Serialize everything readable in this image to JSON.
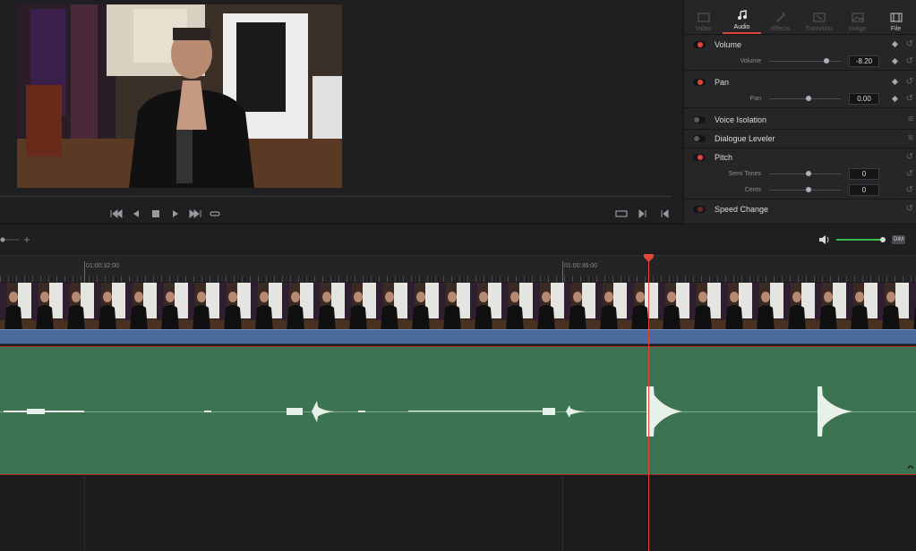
{
  "inspector": {
    "tabs": [
      {
        "label": "Video",
        "icon": "video-icon"
      },
      {
        "label": "Audio",
        "icon": "music-note-icon"
      },
      {
        "label": "Effects",
        "icon": "magic-wand-icon"
      },
      {
        "label": "Transition",
        "icon": "transition-icon"
      },
      {
        "label": "Image",
        "icon": "image-icon"
      },
      {
        "label": "File",
        "icon": "file-icon"
      }
    ],
    "active_tab": "Audio",
    "sections": {
      "volume": {
        "title": "Volume",
        "param_label": "Volume",
        "value": "-8.20",
        "level": 0.8
      },
      "pan": {
        "title": "Pan",
        "param_label": "Pan",
        "value": "0.00",
        "level": 0.55
      },
      "voice_isolation": {
        "title": "Voice Isolation"
      },
      "dialogue_leveler": {
        "title": "Dialogue Leveler"
      },
      "pitch": {
        "title": "Pitch",
        "semi_label": "Semi Tones",
        "semi_value": "0",
        "semi_level": 0.55,
        "cents_label": "Cents",
        "cents_value": "0",
        "cents_level": 0.55
      },
      "speed_change": {
        "title": "Speed Change"
      }
    }
  },
  "timeline": {
    "timecodes": [
      "01:00:32:00",
      "01:00:36:00"
    ],
    "dim_label": "DIM",
    "volume_level": 1.0
  },
  "colors": {
    "accent": "#e0453a",
    "audio_clip": "#3c7350",
    "video_bar": "#4a6a9a"
  }
}
